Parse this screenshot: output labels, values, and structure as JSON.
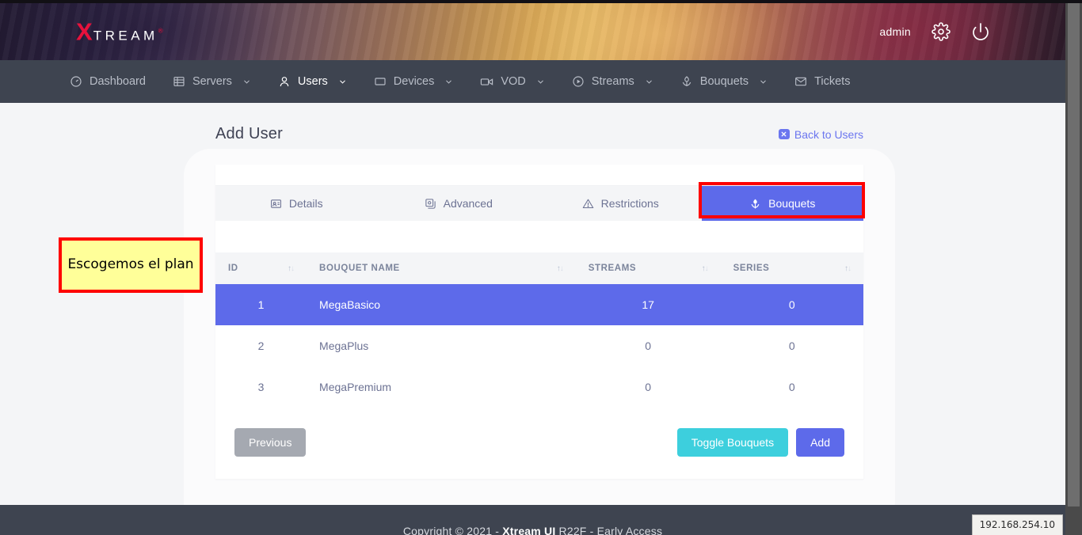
{
  "header": {
    "logo_x": "X",
    "logo_rest": "TREAM",
    "logo_reg": "®",
    "username": "admin",
    "settings_icon": "gear-icon",
    "power_icon": "power-icon"
  },
  "nav": {
    "items": [
      {
        "label": "Dashboard",
        "icon": "dashboard-icon",
        "caret": false,
        "active": false
      },
      {
        "label": "Servers",
        "icon": "server-icon",
        "caret": true,
        "active": false
      },
      {
        "label": "Users",
        "icon": "user-icon",
        "caret": true,
        "active": true
      },
      {
        "label": "Devices",
        "icon": "device-icon",
        "caret": true,
        "active": false
      },
      {
        "label": "VOD",
        "icon": "video-icon",
        "caret": true,
        "active": false
      },
      {
        "label": "Streams",
        "icon": "play-circle-icon",
        "caret": true,
        "active": false
      },
      {
        "label": "Bouquets",
        "icon": "bouquet-icon",
        "caret": true,
        "active": false
      },
      {
        "label": "Tickets",
        "icon": "envelope-icon",
        "caret": false,
        "active": false
      }
    ]
  },
  "page": {
    "title": "Add User",
    "back_link": "Back to Users",
    "back_icon": "close-square-icon"
  },
  "tabs": [
    {
      "label": "Details",
      "icon": "id-card-icon",
      "active": false
    },
    {
      "label": "Advanced",
      "icon": "sliders-icon",
      "active": false
    },
    {
      "label": "Restrictions",
      "icon": "warning-triangle-icon",
      "active": false
    },
    {
      "label": "Bouquets",
      "icon": "bouquet-icon",
      "active": true
    }
  ],
  "table": {
    "columns": [
      {
        "label": "ID",
        "sortable": true
      },
      {
        "label": "BOUQUET NAME",
        "sortable": true
      },
      {
        "label": "STREAMS",
        "sortable": true
      },
      {
        "label": "SERIES",
        "sortable": true
      }
    ],
    "rows": [
      {
        "id": "1",
        "name": "MegaBasico",
        "streams": "17",
        "series": "0",
        "selected": true
      },
      {
        "id": "2",
        "name": "MegaPlus",
        "streams": "0",
        "series": "0",
        "selected": false
      },
      {
        "id": "3",
        "name": "MegaPremium",
        "streams": "0",
        "series": "0",
        "selected": false
      }
    ]
  },
  "buttons": {
    "previous": "Previous",
    "toggle_bouquets": "Toggle Bouquets",
    "add": "Add"
  },
  "annotation": {
    "text": "Escogemos el plan"
  },
  "footer": {
    "copyright_prefix": "Copyright © 2021 - ",
    "copyright_brand": "Xtream UI",
    "copyright_suffix": " R22F - Early Access"
  },
  "status": {
    "ip": "192.168.254.10"
  },
  "colors": {
    "accent_blue": "#5d6aea",
    "teal": "#3dcfdd",
    "gray_button": "#a5a9b1",
    "nav_bg": "#3e4450",
    "page_bg": "#f4f5f7",
    "highlight_red": "#fe0000",
    "annotation_yellow": "#ffff99",
    "logo_red": "#e8113c"
  }
}
